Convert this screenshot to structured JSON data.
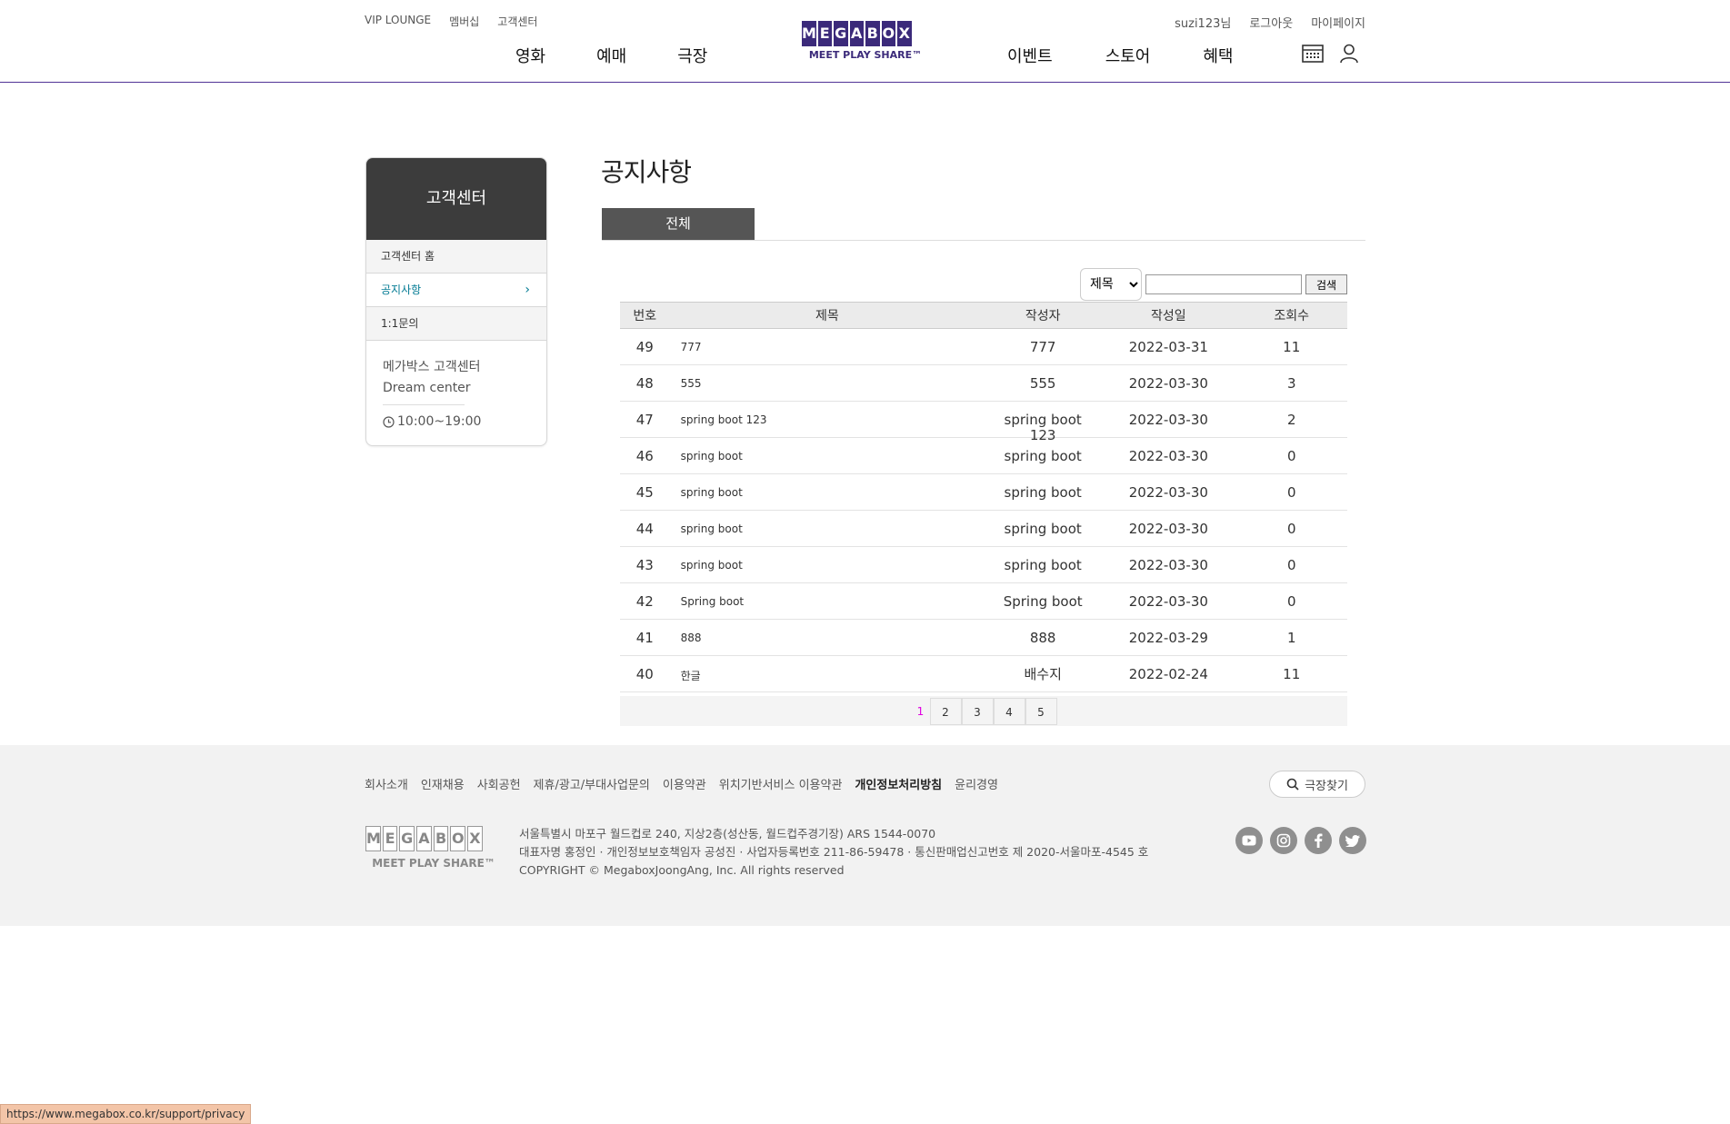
{
  "header": {
    "util_left": [
      "VIP LOUNGE",
      "멤버십",
      "고객센터"
    ],
    "util_right": [
      "suzi123님",
      "로그아웃",
      "마이페이지"
    ],
    "nav_left": [
      "영화",
      "예매",
      "극장"
    ],
    "nav_right": [
      "이벤트",
      "스토어",
      "혜택"
    ],
    "logo_letters": [
      "M",
      "E",
      "G",
      "A",
      "B",
      "O",
      "X"
    ],
    "logo_tagline": "MEET PLAY SHARE™",
    "icons": [
      "calendar-icon",
      "user-icon"
    ],
    "brand_color": "#3b2a7a"
  },
  "sidebar": {
    "title": "고객센터",
    "items": [
      {
        "label": "고객센터 홈",
        "active": false
      },
      {
        "label": "공지사항",
        "active": true
      },
      {
        "label": "1:1문의",
        "active": false
      }
    ],
    "info_name": "메가박스 고객센터",
    "info_sub": "Dream center",
    "info_hours": "10:00~19:00"
  },
  "main": {
    "title": "공지사항",
    "tab_all": "전체",
    "search": {
      "select_value": "제목",
      "input_value": "",
      "button": "검색"
    },
    "table": {
      "headers": [
        "번호",
        "제목",
        "작성자",
        "작성일",
        "조회수"
      ],
      "rows": [
        {
          "no": "49",
          "title": "777",
          "author": "777",
          "date": "2022-03-31",
          "views": "11"
        },
        {
          "no": "48",
          "title": "555",
          "author": "555",
          "date": "2022-03-30",
          "views": "3"
        },
        {
          "no": "47",
          "title": "spring boot 123",
          "author": "spring boot",
          "author2": "123",
          "date": "2022-03-30",
          "views": "2"
        },
        {
          "no": "46",
          "title": "spring boot",
          "author": "spring boot",
          "date": "2022-03-30",
          "views": "0"
        },
        {
          "no": "45",
          "title": "spring boot",
          "author": "spring boot",
          "date": "2022-03-30",
          "views": "0"
        },
        {
          "no": "44",
          "title": "spring boot",
          "author": "spring boot",
          "date": "2022-03-30",
          "views": "0"
        },
        {
          "no": "43",
          "title": "spring boot",
          "author": "spring boot",
          "date": "2022-03-30",
          "views": "0"
        },
        {
          "no": "42",
          "title": "Spring boot",
          "author": "Spring boot",
          "date": "2022-03-30",
          "views": "0"
        },
        {
          "no": "41",
          "title": "888",
          "author": "888",
          "date": "2022-03-29",
          "views": "1"
        },
        {
          "no": "40",
          "title": "한글",
          "author": "배수지",
          "date": "2022-02-24",
          "views": "11"
        }
      ]
    },
    "pagination": {
      "current": "1",
      "pages": [
        "2",
        "3",
        "4",
        "5"
      ],
      "current_color": "#e000e0"
    }
  },
  "footer": {
    "links": [
      "회사소개",
      "인재채용",
      "사회공헌",
      "제휴/광고/부대사업문의",
      "이용약관",
      "위치기반서비스 이용약관",
      "개인정보처리방침",
      "윤리경영"
    ],
    "bold_link_index": 6,
    "theater_search": "극장찾기",
    "logo_letters": [
      "M",
      "E",
      "G",
      "A",
      "B",
      "O",
      "X"
    ],
    "logo_tagline": "MEET PLAY SHARE™",
    "address": "서울특별시 마포구 월드컵로 240, 지상2층(성산동, 월드컵주경기장) ARS 1544-0070",
    "company": "대표자명 홍정인 · 개인정보보호책임자 공성진 · 사업자등록번호 211-86-59478 · 통신판매업신고번호 제 2020-서울마포-4545 호",
    "copyright": "COPYRIGHT © MegaboxJoongAng, Inc. All rights reserved",
    "sns": [
      "youtube-icon",
      "instagram-icon",
      "facebook-icon",
      "twitter-icon"
    ]
  },
  "statusbar": {
    "url": "https://www.megabox.co.kr/support/privacy"
  }
}
